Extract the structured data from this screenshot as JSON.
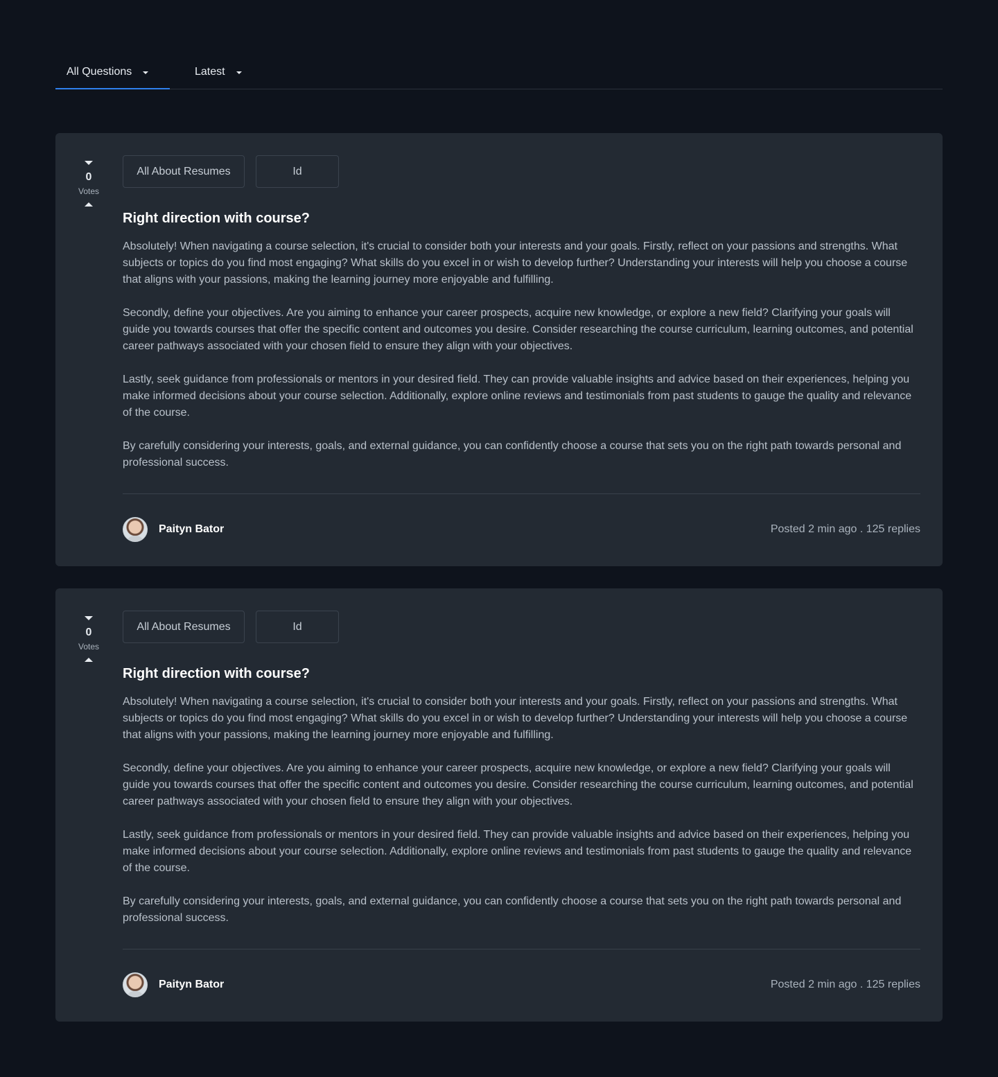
{
  "tabs": [
    {
      "label": "All Questions",
      "active": true
    },
    {
      "label": "Latest",
      "active": false
    }
  ],
  "colors": {
    "background": "#0e131c",
    "card": "#232a33",
    "accent": "#2f80ed"
  },
  "posts": [
    {
      "votes": "0",
      "votes_label": "Votes",
      "tags": [
        "All About Resumes",
        "Id"
      ],
      "title": "Right direction with course?",
      "paragraphs": [
        "Absolutely! When navigating a course selection, it's crucial to consider both your interests and your goals. Firstly, reflect on your passions and strengths. What subjects or topics do you find most engaging? What skills do you excel in or wish to develop further? Understanding your interests will help you choose a course that aligns with your passions, making the learning journey more enjoyable and fulfilling.",
        "Secondly, define your objectives. Are you aiming to enhance your career prospects, acquire new knowledge, or explore a new field? Clarifying your goals will guide you towards courses that offer the specific content and outcomes you desire. Consider researching the course curriculum, learning outcomes, and potential career pathways associated with your chosen field to ensure they align with your objectives.",
        "Lastly, seek guidance from professionals or mentors in your desired field. They can provide valuable insights and advice based on their experiences, helping you make informed decisions about your course selection. Additionally, explore online reviews and testimonials from past students to gauge the quality and relevance of the course.",
        "By carefully considering your interests, goals, and external guidance, you can confidently choose a course that sets you on the right path towards personal and professional success."
      ],
      "author": "Paityn Bator",
      "meta": "Posted 2 min ago . 125 replies"
    },
    {
      "votes": "0",
      "votes_label": "Votes",
      "tags": [
        "All About Resumes",
        "Id"
      ],
      "title": "Right direction with course?",
      "paragraphs": [
        "Absolutely! When navigating a course selection, it's crucial to consider both your interests and your goals. Firstly, reflect on your passions and strengths. What subjects or topics do you find most engaging? What skills do you excel in or wish to develop further? Understanding your interests will help you choose a course that aligns with your passions, making the learning journey more enjoyable and fulfilling.",
        "Secondly, define your objectives. Are you aiming to enhance your career prospects, acquire new knowledge, or explore a new field? Clarifying your goals will guide you towards courses that offer the specific content and outcomes you desire. Consider researching the course curriculum, learning outcomes, and potential career pathways associated with your chosen field to ensure they align with your objectives.",
        "Lastly, seek guidance from professionals or mentors in your desired field. They can provide valuable insights and advice based on their experiences, helping you make informed decisions about your course selection. Additionally, explore online reviews and testimonials from past students to gauge the quality and relevance of the course.",
        "By carefully considering your interests, goals, and external guidance, you can confidently choose a course that sets you on the right path towards personal and professional success."
      ],
      "author": "Paityn Bator",
      "meta": "Posted 2 min ago . 125 replies"
    }
  ]
}
